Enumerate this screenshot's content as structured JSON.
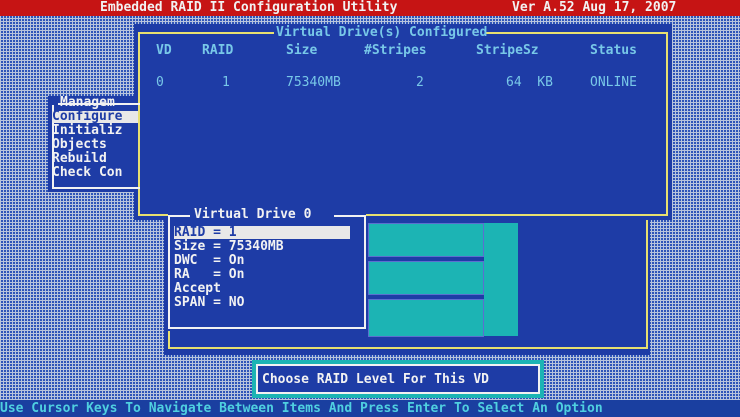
{
  "title": {
    "app_name": "Embedded RAID II Configuration Utility",
    "version": "Ver A.52 Aug 17, 2007"
  },
  "vd_panel": {
    "title": "Virtual Drive(s) Configured",
    "columns": [
      "VD",
      "RAID",
      "Size",
      "#Stripes",
      "StripeSz",
      "Status"
    ],
    "rows": [
      {
        "vd": "0",
        "raid": "1",
        "size": "75340MB",
        "stripes": "2",
        "stripe_size": "64  KB",
        "status": "ONLINE"
      }
    ]
  },
  "management_menu": {
    "title": "Managem",
    "items": [
      "Configure",
      "Initializ",
      "Objects",
      "Rebuild",
      "Check Con"
    ],
    "selected_index": 0
  },
  "vd_detail": {
    "title": "Virtual Drive 0",
    "items": [
      "RAID = 1",
      "Size = 75340MB",
      "DWC  = On",
      "RA   = On",
      "Accept",
      "SPAN = NO"
    ],
    "selected_index": 0
  },
  "hint_box": {
    "text": "Choose RAID Level For This VD"
  },
  "status_bar": {
    "text": "Use Cursor Keys To Navigate Between Items And Press Enter To Select An Option"
  },
  "colors": {
    "title_bar": "#c61414",
    "panel_bg": "#1e3ca6",
    "frame": "#e8e070",
    "teal": "#1cb4b4",
    "status_text": "#4fd0e0"
  }
}
